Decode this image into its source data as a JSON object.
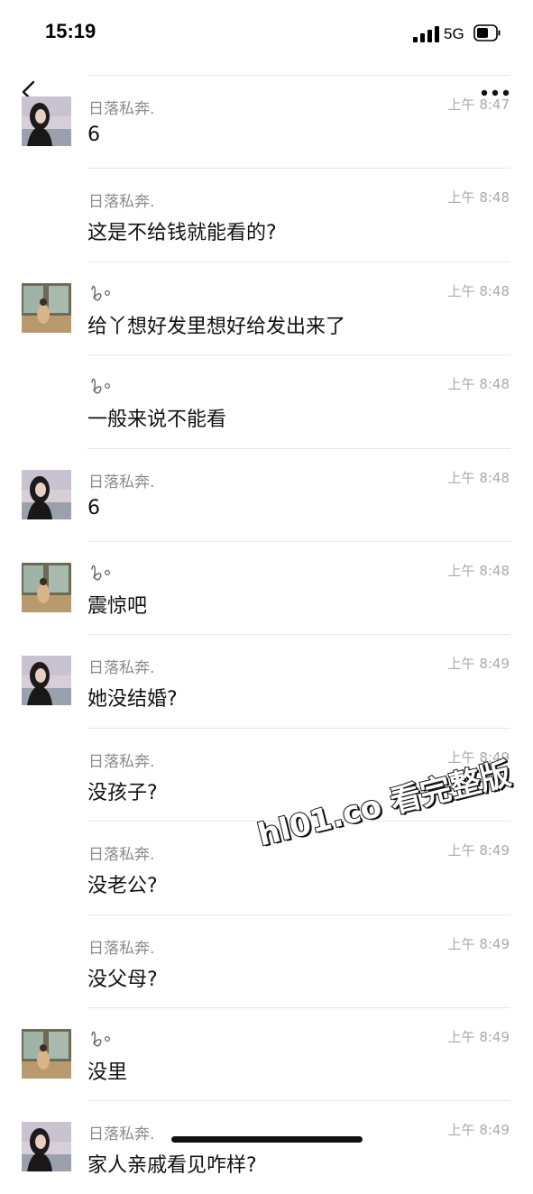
{
  "status_bar": {
    "time": "15:19",
    "network": "5G"
  },
  "watermark": "hl01.co 看完整版",
  "colors": {
    "background": "#ffffff",
    "sender_name": "#8b8b8b",
    "time": "#aaaaaa",
    "message_text": "#111111"
  },
  "messages": [
    {
      "sender": "日落私奔.",
      "avatar": "woman-portrait",
      "time": "上午 8:47",
      "text": "6"
    },
    {
      "sender": "日落私奔.",
      "avatar": null,
      "time": "上午 8:48",
      "text": "这是不给钱就能看的?"
    },
    {
      "sender": "",
      "sender_icon": "squiggle-icon",
      "avatar": "interior-photo",
      "time": "上午 8:48",
      "text": "给丫想好发里想好给发出来了"
    },
    {
      "sender": "",
      "sender_icon": "squiggle-icon",
      "avatar": null,
      "time": "上午 8:48",
      "text": "一般来说不能看"
    },
    {
      "sender": "日落私奔.",
      "avatar": "woman-portrait",
      "time": "上午 8:48",
      "text": "6"
    },
    {
      "sender": "",
      "sender_icon": "squiggle-icon",
      "avatar": "interior-photo",
      "time": "上午 8:48",
      "text": "震惊吧"
    },
    {
      "sender": "日落私奔.",
      "avatar": "woman-portrait",
      "time": "上午 8:49",
      "text": "她没结婚?"
    },
    {
      "sender": "日落私奔.",
      "avatar": null,
      "time": "上午 8:49",
      "text": "没孩子?"
    },
    {
      "sender": "日落私奔.",
      "avatar": null,
      "time": "上午 8:49",
      "text": "没老公?"
    },
    {
      "sender": "日落私奔.",
      "avatar": null,
      "time": "上午 8:49",
      "text": "没父母?"
    },
    {
      "sender": "",
      "sender_icon": "squiggle-icon",
      "avatar": "interior-photo",
      "time": "上午 8:49",
      "text": "没里"
    },
    {
      "sender": "日落私奔.",
      "avatar": "woman-portrait",
      "time": "上午 8:49",
      "text": "家人亲戚看见咋样?"
    }
  ]
}
